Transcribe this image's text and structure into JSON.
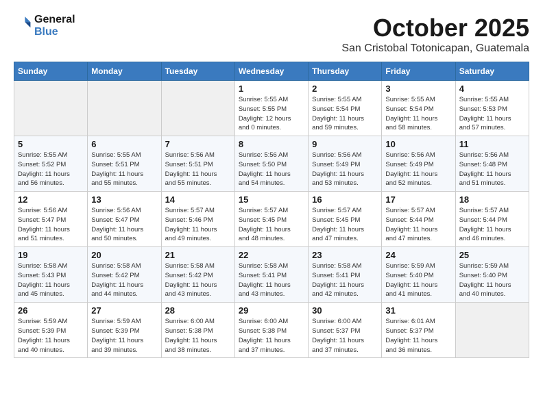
{
  "header": {
    "logo_line1": "General",
    "logo_line2": "Blue",
    "month_year": "October 2025",
    "location": "San Cristobal Totonicapan, Guatemala"
  },
  "weekdays": [
    "Sunday",
    "Monday",
    "Tuesday",
    "Wednesday",
    "Thursday",
    "Friday",
    "Saturday"
  ],
  "weeks": [
    [
      {
        "day": "",
        "info": ""
      },
      {
        "day": "",
        "info": ""
      },
      {
        "day": "",
        "info": ""
      },
      {
        "day": "1",
        "info": "Sunrise: 5:55 AM\nSunset: 5:55 PM\nDaylight: 12 hours\nand 0 minutes."
      },
      {
        "day": "2",
        "info": "Sunrise: 5:55 AM\nSunset: 5:54 PM\nDaylight: 11 hours\nand 59 minutes."
      },
      {
        "day": "3",
        "info": "Sunrise: 5:55 AM\nSunset: 5:54 PM\nDaylight: 11 hours\nand 58 minutes."
      },
      {
        "day": "4",
        "info": "Sunrise: 5:55 AM\nSunset: 5:53 PM\nDaylight: 11 hours\nand 57 minutes."
      }
    ],
    [
      {
        "day": "5",
        "info": "Sunrise: 5:55 AM\nSunset: 5:52 PM\nDaylight: 11 hours\nand 56 minutes."
      },
      {
        "day": "6",
        "info": "Sunrise: 5:55 AM\nSunset: 5:51 PM\nDaylight: 11 hours\nand 55 minutes."
      },
      {
        "day": "7",
        "info": "Sunrise: 5:56 AM\nSunset: 5:51 PM\nDaylight: 11 hours\nand 55 minutes."
      },
      {
        "day": "8",
        "info": "Sunrise: 5:56 AM\nSunset: 5:50 PM\nDaylight: 11 hours\nand 54 minutes."
      },
      {
        "day": "9",
        "info": "Sunrise: 5:56 AM\nSunset: 5:49 PM\nDaylight: 11 hours\nand 53 minutes."
      },
      {
        "day": "10",
        "info": "Sunrise: 5:56 AM\nSunset: 5:49 PM\nDaylight: 11 hours\nand 52 minutes."
      },
      {
        "day": "11",
        "info": "Sunrise: 5:56 AM\nSunset: 5:48 PM\nDaylight: 11 hours\nand 51 minutes."
      }
    ],
    [
      {
        "day": "12",
        "info": "Sunrise: 5:56 AM\nSunset: 5:47 PM\nDaylight: 11 hours\nand 51 minutes."
      },
      {
        "day": "13",
        "info": "Sunrise: 5:56 AM\nSunset: 5:47 PM\nDaylight: 11 hours\nand 50 minutes."
      },
      {
        "day": "14",
        "info": "Sunrise: 5:57 AM\nSunset: 5:46 PM\nDaylight: 11 hours\nand 49 minutes."
      },
      {
        "day": "15",
        "info": "Sunrise: 5:57 AM\nSunset: 5:45 PM\nDaylight: 11 hours\nand 48 minutes."
      },
      {
        "day": "16",
        "info": "Sunrise: 5:57 AM\nSunset: 5:45 PM\nDaylight: 11 hours\nand 47 minutes."
      },
      {
        "day": "17",
        "info": "Sunrise: 5:57 AM\nSunset: 5:44 PM\nDaylight: 11 hours\nand 47 minutes."
      },
      {
        "day": "18",
        "info": "Sunrise: 5:57 AM\nSunset: 5:44 PM\nDaylight: 11 hours\nand 46 minutes."
      }
    ],
    [
      {
        "day": "19",
        "info": "Sunrise: 5:58 AM\nSunset: 5:43 PM\nDaylight: 11 hours\nand 45 minutes."
      },
      {
        "day": "20",
        "info": "Sunrise: 5:58 AM\nSunset: 5:42 PM\nDaylight: 11 hours\nand 44 minutes."
      },
      {
        "day": "21",
        "info": "Sunrise: 5:58 AM\nSunset: 5:42 PM\nDaylight: 11 hours\nand 43 minutes."
      },
      {
        "day": "22",
        "info": "Sunrise: 5:58 AM\nSunset: 5:41 PM\nDaylight: 11 hours\nand 43 minutes."
      },
      {
        "day": "23",
        "info": "Sunrise: 5:58 AM\nSunset: 5:41 PM\nDaylight: 11 hours\nand 42 minutes."
      },
      {
        "day": "24",
        "info": "Sunrise: 5:59 AM\nSunset: 5:40 PM\nDaylight: 11 hours\nand 41 minutes."
      },
      {
        "day": "25",
        "info": "Sunrise: 5:59 AM\nSunset: 5:40 PM\nDaylight: 11 hours\nand 40 minutes."
      }
    ],
    [
      {
        "day": "26",
        "info": "Sunrise: 5:59 AM\nSunset: 5:39 PM\nDaylight: 11 hours\nand 40 minutes."
      },
      {
        "day": "27",
        "info": "Sunrise: 5:59 AM\nSunset: 5:39 PM\nDaylight: 11 hours\nand 39 minutes."
      },
      {
        "day": "28",
        "info": "Sunrise: 6:00 AM\nSunset: 5:38 PM\nDaylight: 11 hours\nand 38 minutes."
      },
      {
        "day": "29",
        "info": "Sunrise: 6:00 AM\nSunset: 5:38 PM\nDaylight: 11 hours\nand 37 minutes."
      },
      {
        "day": "30",
        "info": "Sunrise: 6:00 AM\nSunset: 5:37 PM\nDaylight: 11 hours\nand 37 minutes."
      },
      {
        "day": "31",
        "info": "Sunrise: 6:01 AM\nSunset: 5:37 PM\nDaylight: 11 hours\nand 36 minutes."
      },
      {
        "day": "",
        "info": ""
      }
    ]
  ]
}
